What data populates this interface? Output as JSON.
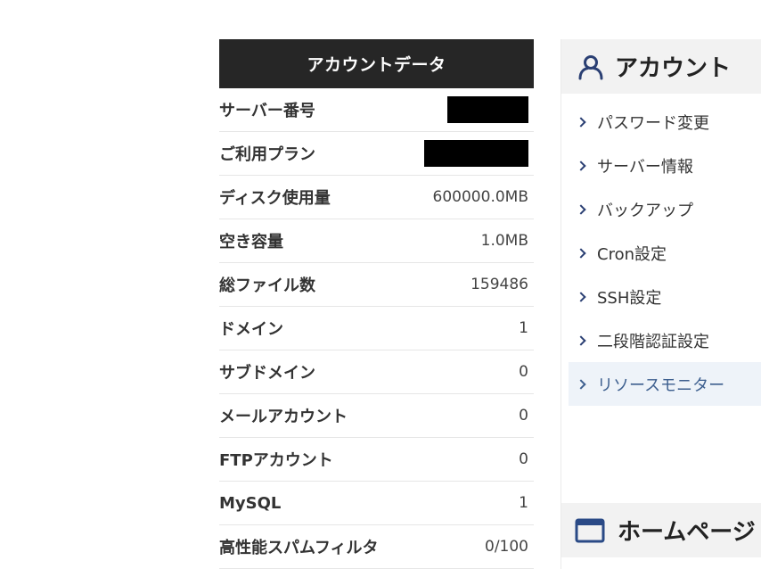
{
  "account_data": {
    "header": "アカウントデータ",
    "rows": [
      {
        "label": "サーバー番号",
        "value": ""
      },
      {
        "label": "ご利用プラン",
        "value": ""
      },
      {
        "label": "ディスク使用量",
        "value": "600000.0MB"
      },
      {
        "label": "空き容量",
        "value": "1.0MB"
      },
      {
        "label": "総ファイル数",
        "value": "159486"
      },
      {
        "label": "ドメイン",
        "value": "1"
      },
      {
        "label": "サブドメイン",
        "value": "0"
      },
      {
        "label": "メールアカウント",
        "value": "0"
      },
      {
        "label": "FTPアカウント",
        "value": "0"
      },
      {
        "label": "MySQL",
        "value": "1"
      },
      {
        "label": "高性能スパムフィルタ",
        "value": "0/100"
      }
    ]
  },
  "account_panel": {
    "title": "アカウント",
    "icon": "user-icon",
    "accent_color": "#2a3f73",
    "items": [
      {
        "label": "パスワード変更",
        "active": false
      },
      {
        "label": "サーバー情報",
        "active": false
      },
      {
        "label": "バックアップ",
        "active": false
      },
      {
        "label": "Cron設定",
        "active": false
      },
      {
        "label": "SSH設定",
        "active": false
      },
      {
        "label": "二段階認証設定",
        "active": false
      },
      {
        "label": "リソースモニター",
        "active": true
      }
    ]
  },
  "homepage_panel": {
    "title": "ホームページ",
    "icon": "window-icon"
  }
}
